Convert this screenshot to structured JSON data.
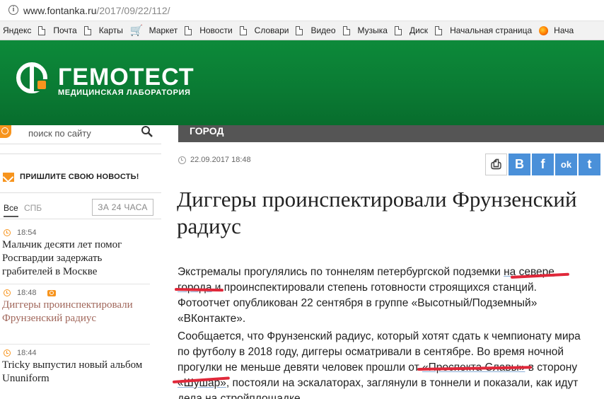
{
  "browser": {
    "url_host": "www.fontanka.ru",
    "url_path": "/2017/09/22/112/"
  },
  "bookmarks": [
    {
      "label": "Яндекс",
      "icon": "none"
    },
    {
      "label": "Почта",
      "icon": "document-icon"
    },
    {
      "label": "Карты",
      "icon": "document-icon"
    },
    {
      "label": "Маркет",
      "icon": "cart-icon"
    },
    {
      "label": "Новости",
      "icon": "document-icon"
    },
    {
      "label": "Словари",
      "icon": "document-icon"
    },
    {
      "label": "Видео",
      "icon": "document-icon"
    },
    {
      "label": "Музыка",
      "icon": "document-icon"
    },
    {
      "label": "Диск",
      "icon": "document-icon"
    },
    {
      "label": "Начальная страница",
      "icon": "document-icon"
    },
    {
      "label": "Нача",
      "icon": "firefox-icon"
    }
  ],
  "banner": {
    "title": "ГЕМОТЕСТ",
    "subtitle": "МЕДИЦИНСКАЯ ЛАБОРАТОРИЯ",
    "color": "#0a7a33"
  },
  "sidebar": {
    "search_placeholder": "поиск по сайту",
    "submit_news": "ПРИШЛИТЕ СВОЮ НОВОСТЬ!",
    "tabs": {
      "all": "Все",
      "spb": "СПБ"
    },
    "hours_button": "ЗА 24 ЧАСА",
    "news": [
      {
        "time": "18:54",
        "title": "Мальчик десяти лет помог Росгвардии задержать грабителей в Москве",
        "camera": false
      },
      {
        "time": "18:48",
        "title": "Диггеры проинспектировали Фрунзенский радиус",
        "camera": true
      },
      {
        "time": "18:44",
        "title": "Tricky выпустил новый альбом Ununiform",
        "camera": false
      }
    ]
  },
  "article": {
    "section": "ГОРОД",
    "date": "22.09.2017 18:48",
    "title": "Диггеры проинспектировали Фрунзенский радиус",
    "p1_a": "Экстремалы прогулялись по тоннелям петербургской подземки ",
    "p1_link": "на севере города",
    "p1_b": " и проинспектировали степень готовности строящихся станций. Фотоотчет опубликован 22 сентября в группе «Высотный/Подземный» «ВКонтакте».",
    "p2_a": "Сообщается, что Фрунзенский радиус, который хотят сдать к чемпионату мира по футболу в 2018 году, диггеры осматривали в сентябре. Во время ночной прогулки не меньше девяти человек прошли от ",
    "p2_link1": "«Проспекта Славы»",
    "p2_b": " в сторону ",
    "p2_link2": "«Шушар»",
    "p2_c": ", постояли на эскалаторах, заглянули в тоннели и показали, как идут дела на стройплощадке.",
    "share": {
      "print": "⎙",
      "vk": "B",
      "fb": "f",
      "ok": "ok",
      "tw": "t"
    }
  },
  "colors": {
    "accent": "#f7941d",
    "section_bar": "#555555",
    "highlight_mark": "#e0283a",
    "share": "#4a90d9"
  }
}
